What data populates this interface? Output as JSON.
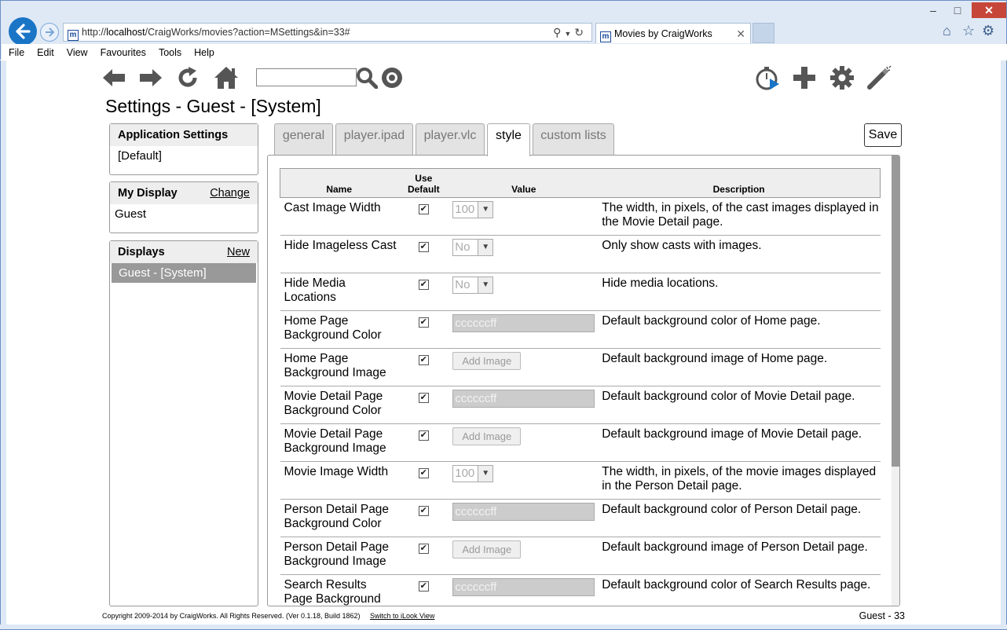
{
  "browser": {
    "url_prefix": "http://",
    "url_host": "localhost",
    "url_path": "/CraigWorks/movies?action=MSettings&in=33#",
    "tab_title": "Movies by CraigWorks",
    "favicon_letter": "m",
    "menu": [
      "File",
      "Edit",
      "View",
      "Favourites",
      "Tools",
      "Help"
    ]
  },
  "page": {
    "title": "Settings - Guest - [System]",
    "search_value": ""
  },
  "sidebar": {
    "app_settings": {
      "header": "Application Settings",
      "item": "[Default]"
    },
    "my_display": {
      "header": "My Display",
      "link": "Change",
      "value": "Guest"
    },
    "displays": {
      "header": "Displays",
      "link": "New",
      "selected": "Guest - [System]"
    }
  },
  "tabs": [
    "general",
    "player.ipad",
    "player.vlc",
    "style",
    "custom lists"
  ],
  "active_tab": "style",
  "save_label": "Save",
  "table": {
    "headers": {
      "name": "Name",
      "use_default_1": "Use",
      "use_default_2": "Default",
      "value": "Value",
      "description": "Description"
    },
    "rows": [
      {
        "name": "Cast Image Width",
        "checked": "✔",
        "value_type": "select",
        "value": "100",
        "description": "The width, in pixels, of the cast images displayed in the Movie Detail page."
      },
      {
        "name": "Hide Imageless Cast",
        "checked": "✔",
        "value_type": "select",
        "value": "No",
        "description": "Only show casts with images."
      },
      {
        "name": "Hide Media Locations",
        "checked": "✔",
        "value_type": "select",
        "value": "No",
        "description": "Hide media locations."
      },
      {
        "name": "Home Page Background Color",
        "checked": "✔",
        "value_type": "color",
        "value": "ccccccff",
        "description": "Default background color of Home page."
      },
      {
        "name": "Home Page Background Image",
        "checked": "✔",
        "value_type": "button",
        "value": "Add Image",
        "description": "Default background image of Home page."
      },
      {
        "name": "Movie Detail Page Background Color",
        "checked": "✔",
        "value_type": "color",
        "value": "ccccccff",
        "description": "Default background color of Movie Detail page."
      },
      {
        "name": "Movie Detail Page Background Image",
        "checked": "✔",
        "value_type": "button",
        "value": "Add Image",
        "description": "Default background image of Movie Detail page."
      },
      {
        "name": "Movie Image Width",
        "checked": "✔",
        "value_type": "select",
        "value": "100",
        "description": "The width, in pixels, of the movie images displayed in the Person Detail page."
      },
      {
        "name": "Person Detail Page Background Color",
        "checked": "✔",
        "value_type": "color",
        "value": "ccccccff",
        "description": "Default background color of Person Detail page."
      },
      {
        "name": "Person Detail Page Background Image",
        "checked": "✔",
        "value_type": "button",
        "value": "Add Image",
        "description": "Default background image of Person Detail page."
      },
      {
        "name": "Search Results Page Background",
        "checked": "✔",
        "value_type": "color",
        "value": "ccccccff",
        "description": "Default background color of Search Results page."
      }
    ]
  },
  "footer": {
    "copyright": "Copyright 2009-2014 by CraigWorks. All Rights Reserved. (Ver 0.1.18, Build 1862)",
    "switch_link": "Switch to iLook View",
    "user_status": "Guest - 33"
  },
  "colors": {
    "browser_blue": "#1a75c6",
    "chrome_bg": "#dfe9f5",
    "close_red": "#c7463a",
    "toolbar_icon": "#555555",
    "selected_item": "#999999"
  }
}
